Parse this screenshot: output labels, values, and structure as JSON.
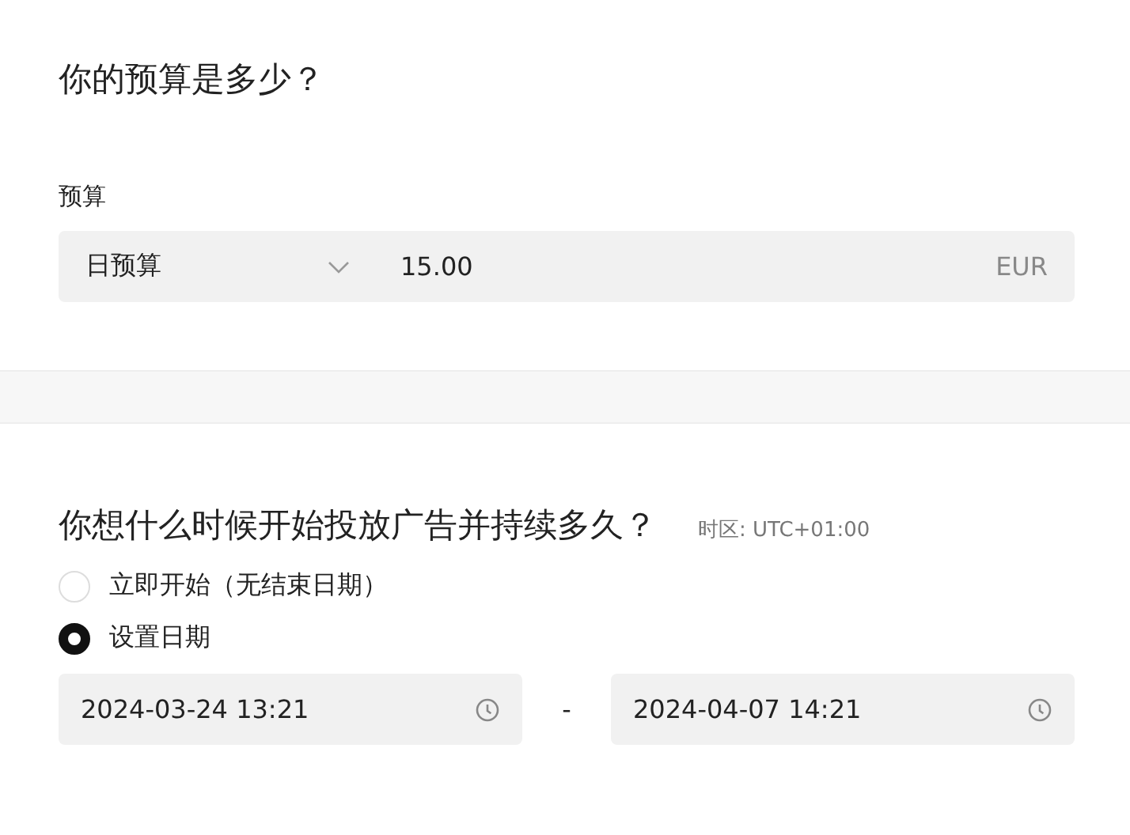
{
  "budget_section": {
    "title": "你的预算是多少？",
    "field_label": "预算",
    "budget_type": "日预算",
    "amount": "15.00",
    "currency": "EUR"
  },
  "schedule_section": {
    "title": "你想什么时候开始投放广告并持续多久？",
    "timezone": "时区: UTC+01:00",
    "options": [
      {
        "label": "立即开始（无结束日期）",
        "selected": false
      },
      {
        "label": "设置日期",
        "selected": true
      }
    ],
    "start": "2024-03-24 13:21",
    "separator": "-",
    "end": "2024-04-07 14:21"
  }
}
